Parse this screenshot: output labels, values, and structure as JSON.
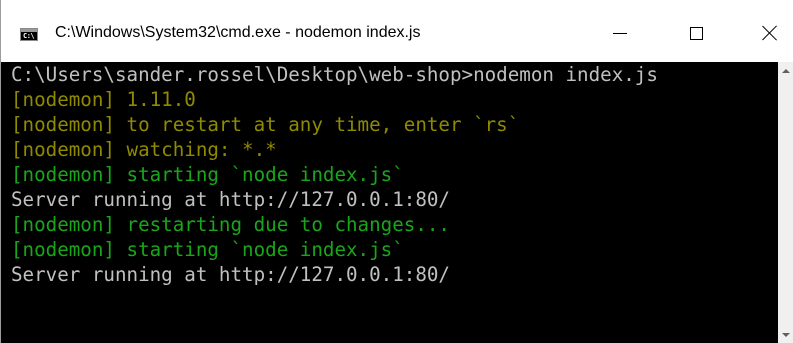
{
  "window": {
    "title": "C:\\Windows\\System32\\cmd.exe - nodemon  index.js",
    "icon_text": "C:\\",
    "controls": [
      "minimize",
      "maximize",
      "close"
    ]
  },
  "colors": {
    "console_bg": "#000000",
    "text_default": "#c0c0c0",
    "text_yellow": "#8f8a00",
    "text_green": "#1aa61a"
  },
  "console": {
    "lines": [
      {
        "text": "C:\\Users\\sander.rossel\\Desktop\\web-shop>nodemon index.js",
        "color": "white"
      },
      {
        "text": "[nodemon] 1.11.0",
        "color": "yellow"
      },
      {
        "text": "[nodemon] to restart at any time, enter `rs`",
        "color": "yellow"
      },
      {
        "text": "[nodemon] watching: *.*",
        "color": "yellow"
      },
      {
        "text": "[nodemon] starting `node index.js`",
        "color": "green"
      },
      {
        "text": "Server running at http://127.0.0.1:80/",
        "color": "white"
      },
      {
        "text": "[nodemon] restarting due to changes...",
        "color": "green"
      },
      {
        "text": "[nodemon] starting `node index.js`",
        "color": "green"
      },
      {
        "text": "Server running at http://127.0.0.1:80/",
        "color": "white"
      }
    ]
  }
}
